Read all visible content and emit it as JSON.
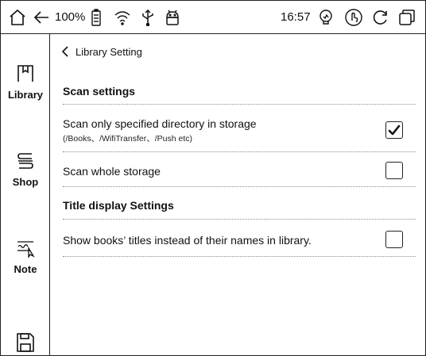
{
  "status_bar": {
    "battery_percent": "100%",
    "time": "16:57",
    "icons": [
      "home-icon",
      "back-arrow-icon",
      "battery-icon",
      "wifi-icon",
      "usb-icon",
      "android-icon",
      "light-bulb-icon",
      "touch-icon",
      "refresh-icon",
      "recent-apps-icon"
    ]
  },
  "sidebar": {
    "items": [
      {
        "label": "Library",
        "icon": "library-icon"
      },
      {
        "label": "Shop",
        "icon": "shop-icon"
      },
      {
        "label": "Note",
        "icon": "note-icon"
      },
      {
        "label": "",
        "icon": "save-icon"
      }
    ]
  },
  "page": {
    "back_label": "Library Setting"
  },
  "sections": [
    {
      "title": "Scan settings",
      "rows": [
        {
          "label": "Scan only specified directory in storage",
          "sublabel": "(/Books、/WifiTransfer、/Push etc)",
          "checked": true
        },
        {
          "label": "Scan whole storage",
          "checked": false
        }
      ]
    },
    {
      "title": "Title display Settings",
      "rows": [
        {
          "label": "Show books’ titles instead of their names in library.",
          "checked": false
        }
      ]
    }
  ]
}
